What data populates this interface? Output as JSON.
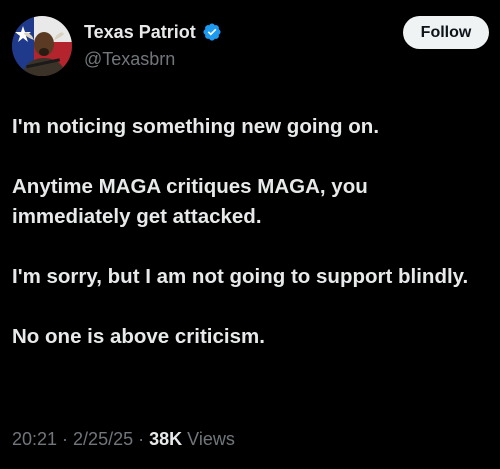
{
  "author": {
    "display_name": "Texas Patriot",
    "handle": "@Texasbrn",
    "verified": true,
    "verified_color": "#1d9bf0"
  },
  "follow_button": {
    "label": "Follow"
  },
  "tweet": {
    "paragraphs": [
      "I'm noticing something new going on.",
      "Anytime MAGA critiques MAGA, you immediately get attacked.",
      "I'm sorry, but I am not going to support blindly.",
      "No one is above criticism."
    ]
  },
  "meta": {
    "time": "20:21",
    "separator": " · ",
    "date": "2/25/25",
    "views_count": "38K",
    "views_label": "Views"
  },
  "colors": {
    "background": "#000000",
    "primary_text": "#e7e9ea",
    "secondary_text": "#71767b",
    "follow_bg": "#eff3f4"
  }
}
